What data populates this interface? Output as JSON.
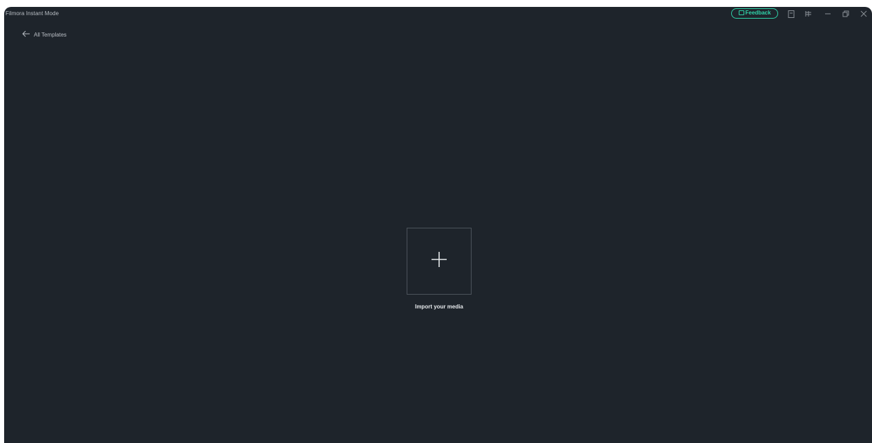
{
  "window": {
    "title": "Filmora Instant Mode"
  },
  "titlebar": {
    "feedback_label": "Feedback",
    "icons": [
      "save-icon",
      "layout-icon",
      "minimize-icon",
      "restore-icon",
      "close-icon"
    ]
  },
  "nav": {
    "back_label": "All Templates"
  },
  "main": {
    "import_label": "Import your media"
  },
  "colors": {
    "background": "#1e242b",
    "accent": "#2fd3a9",
    "border": "#4c535b",
    "text": "#b9bec4"
  }
}
